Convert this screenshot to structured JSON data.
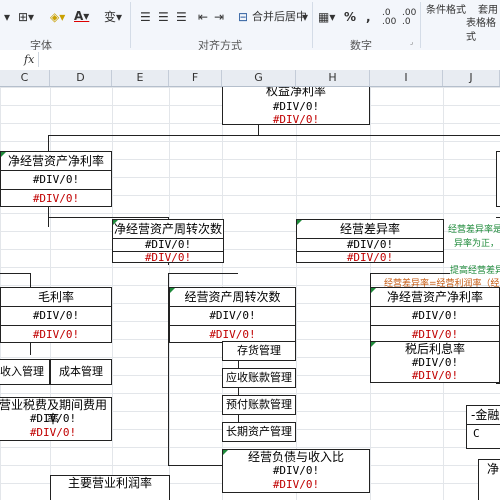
{
  "ribbon": {
    "font_group": "字体",
    "align_group": "对齐方式",
    "number_group": "数字",
    "merge_center": "合并后居中",
    "percent": "%",
    "comma": ",",
    "cond_format": "条件格式",
    "apply_table": "套用",
    "table_format": "表格格式"
  },
  "formula_bar": {
    "fx": "fx"
  },
  "columns": [
    "C",
    "D",
    "E",
    "F",
    "G",
    "H",
    "I",
    "J"
  ],
  "err": "#DIV/0!",
  "boxes": {
    "roe": "权益净利率",
    "net_op_roa": "净经营资产净利率",
    "turnover": "净经营资产周转次数",
    "op_spread": "经营差异率",
    "profit_margin": "毛利率",
    "op_asset_turnover": "经营资产周转次数",
    "net_op_roa2": "净经营资产净利率",
    "after_tax_rate": "税后利息率",
    "op_debt_income": "经营负债与收入比",
    "main_profit_margin": "主要营业利润率",
    "net_partial": "净",
    "finance_partial": "-金融"
  },
  "small_boxes": {
    "income_mgmt": "收入管理",
    "cost_mgmt": "成本管理",
    "tax_expense": "营业税费及期间费用率",
    "inventory": "存货管理",
    "receivables": "应收账款管理",
    "prepaid": "预付账款管理",
    "long_assets": "长期资产管理"
  },
  "notes": {
    "n1": "经营差异率是",
    "n2": "异率为正，",
    "n3": "提高经营差异",
    "n4": "经营差异率=经营利润率（经营"
  },
  "colors": {
    "error_red": "#c00000",
    "note_green": "#1e8a3a",
    "note_orange": "#c55a11"
  }
}
